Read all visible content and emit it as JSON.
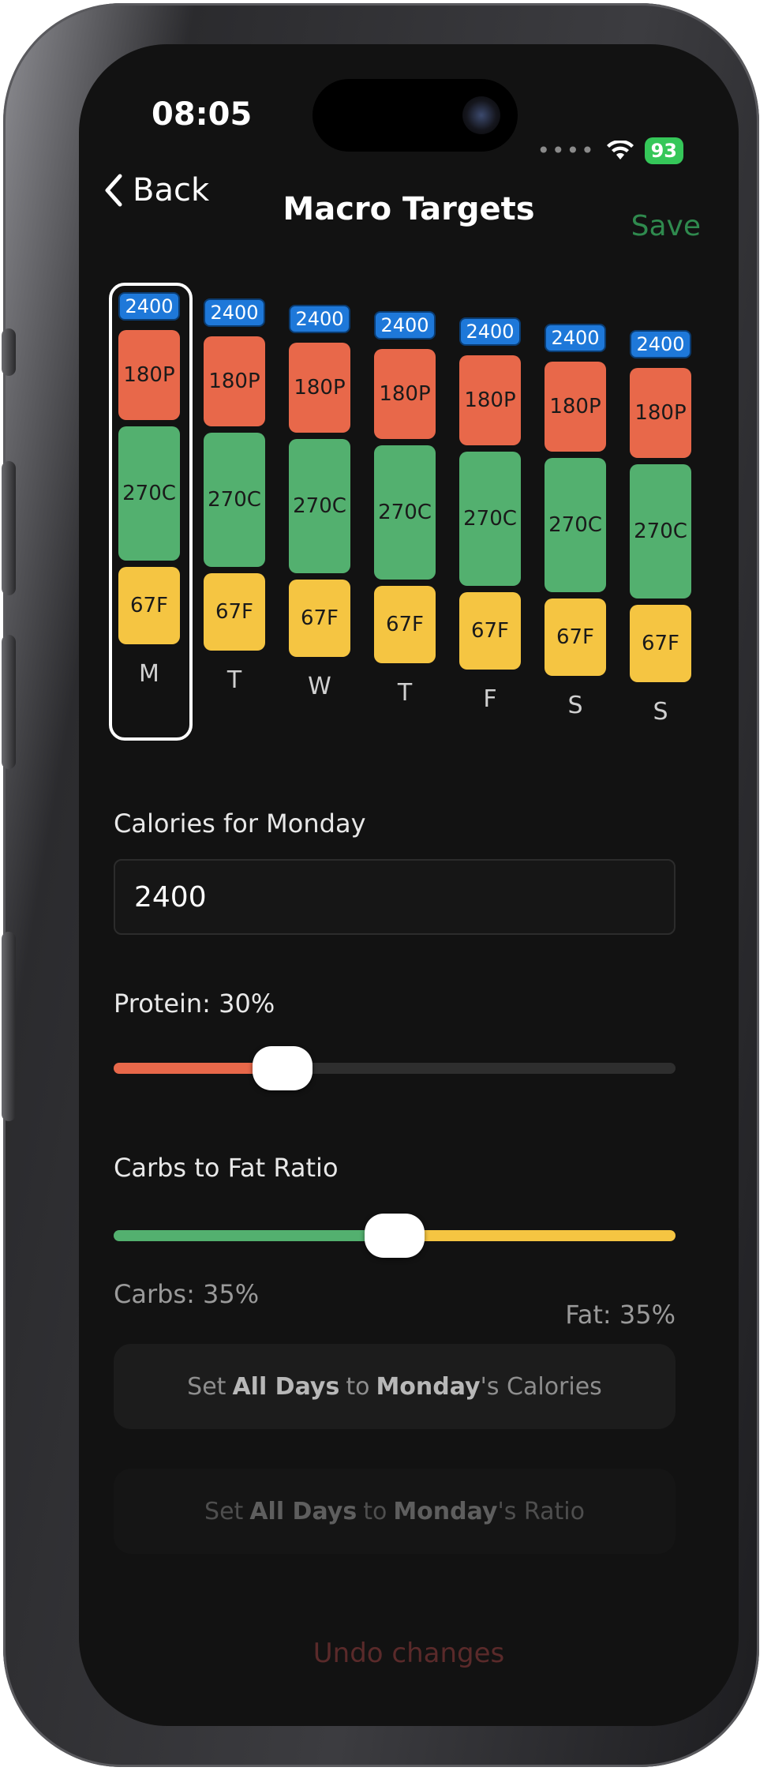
{
  "status": {
    "time": "08:05",
    "battery": "93"
  },
  "nav": {
    "back_label": "Back",
    "title": "Macro Targets",
    "save_label": "Save"
  },
  "days": [
    {
      "letter": "M",
      "calories": "2400",
      "protein": "180P",
      "carbs": "270C",
      "fat": "67F",
      "selected": true
    },
    {
      "letter": "T",
      "calories": "2400",
      "protein": "180P",
      "carbs": "270C",
      "fat": "67F"
    },
    {
      "letter": "W",
      "calories": "2400",
      "protein": "180P",
      "carbs": "270C",
      "fat": "67F"
    },
    {
      "letter": "T",
      "calories": "2400",
      "protein": "180P",
      "carbs": "270C",
      "fat": "67F"
    },
    {
      "letter": "F",
      "calories": "2400",
      "protein": "180P",
      "carbs": "270C",
      "fat": "67F"
    },
    {
      "letter": "S",
      "calories": "2400",
      "protein": "180P",
      "carbs": "270C",
      "fat": "67F"
    },
    {
      "letter": "S",
      "calories": "2400",
      "protein": "180P",
      "carbs": "270C",
      "fat": "67F"
    }
  ],
  "calories": {
    "label": "Calories for Monday",
    "value": "2400"
  },
  "protein": {
    "label": "Protein: 30%",
    "fraction": 0.3
  },
  "ratio": {
    "label": "Carbs to Fat Ratio",
    "fraction": 0.5,
    "carbs_label": "Carbs: 35%",
    "fat_label": "Fat: 35%"
  },
  "actions": {
    "set_calories": {
      "pre": "Set",
      "bold1": "All Days",
      "mid": "to",
      "bold2": "Monday",
      "post": "'s Calories"
    },
    "set_ratio": {
      "pre": "Set",
      "bold1": "All Days",
      "mid": "to",
      "bold2": "Monday",
      "post": "'s Ratio"
    },
    "undo_label": "Undo changes"
  },
  "colors": {
    "protein": "#e8684a",
    "carbs": "#53b06f",
    "fat": "#f5c542",
    "calories_chip": "#1e78d9",
    "save": "#2f8a4e"
  }
}
